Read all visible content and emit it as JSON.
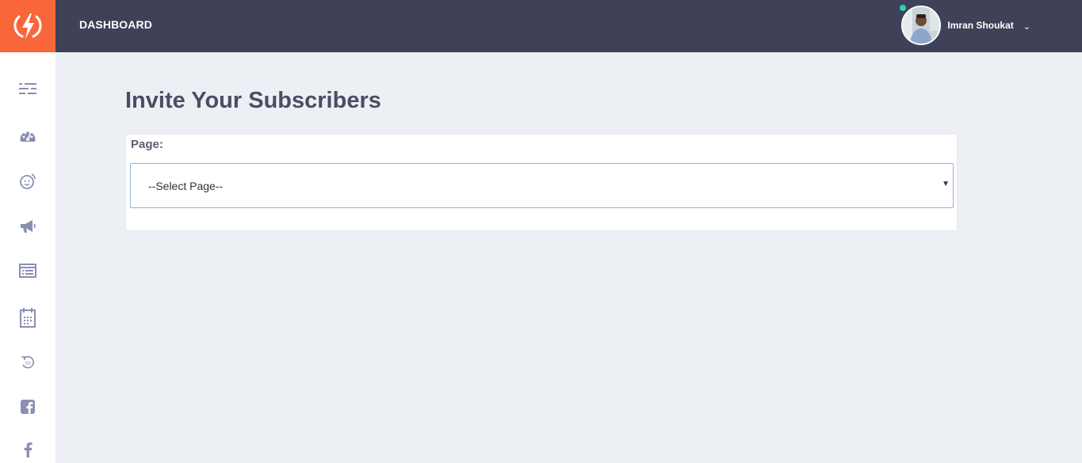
{
  "header": {
    "title": "DASHBOARD",
    "user_name": "Imran Shoukat",
    "user_menu_icon": "chevron-down-icon",
    "logo_icon": "lightning-bolt-icon"
  },
  "sidebar": {
    "items": [
      {
        "icon": "menu-list-icon"
      },
      {
        "icon": "dashboard-gauge-icon"
      },
      {
        "icon": "bot-face-icon"
      },
      {
        "icon": "megaphone-icon"
      },
      {
        "icon": "list-window-icon"
      },
      {
        "icon": "calendar-icon"
      },
      {
        "icon": "history-icon"
      },
      {
        "icon": "facebook-square-icon"
      },
      {
        "icon": "facebook-icon"
      }
    ]
  },
  "main": {
    "title": "Invite Your Subscribers",
    "page_label": "Page:",
    "page_select_value": "--Select Page--"
  },
  "colors": {
    "accent": "#f9663a",
    "topbar": "#3e4157",
    "background": "#ecf0f4",
    "sidebar_icon": "#8a8fb3",
    "online": "#2ad4b8"
  }
}
